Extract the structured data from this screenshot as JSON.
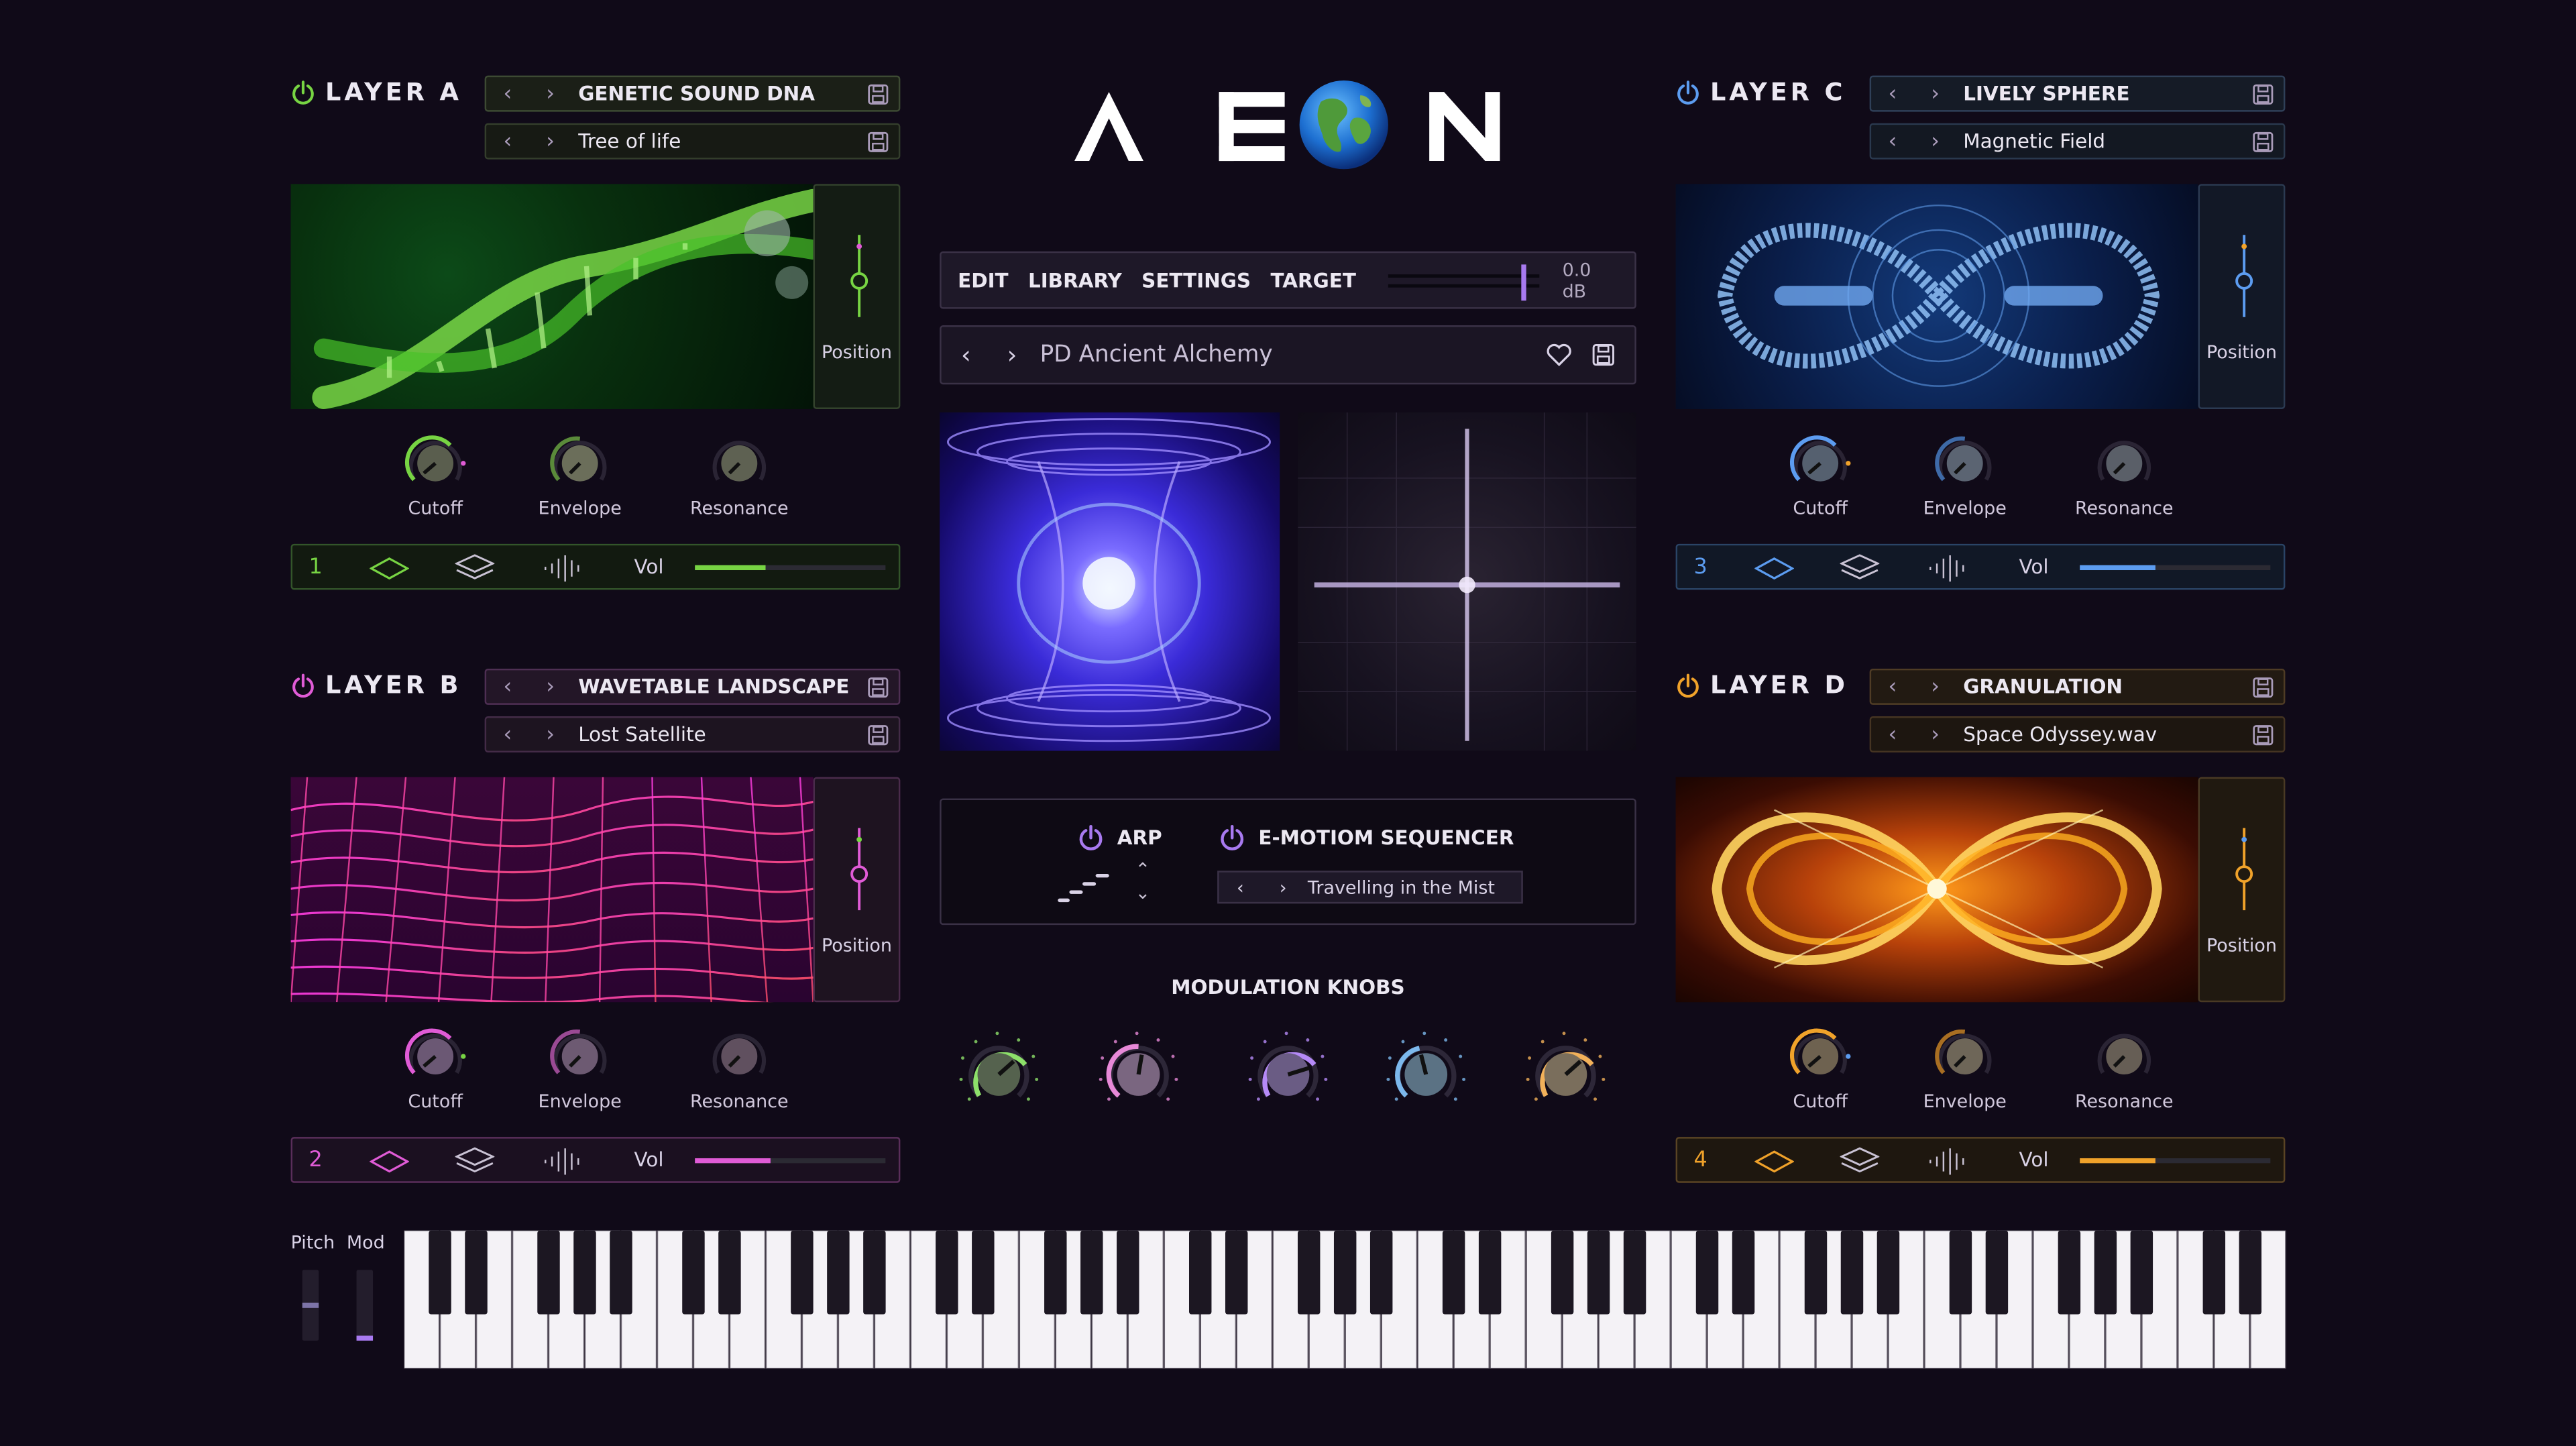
{
  "app": {
    "logo_text": "AEON",
    "logo_letters": [
      "A",
      "E",
      "N"
    ]
  },
  "colors": {
    "a": "#77d443",
    "b": "#e05bd6",
    "c": "#5c9cf0",
    "d": "#f0a22a",
    "bg": "#100a18"
  },
  "layers": [
    {
      "id": "a",
      "title": "LAYER A",
      "preset": "GENETIC SOUND DNA",
      "sample": "Tree of life",
      "position_label": "Position",
      "knobs": [
        "Cutoff",
        "Envelope",
        "Resonance"
      ],
      "number": "1",
      "vol_label": "Vol",
      "vol": 0.37
    },
    {
      "id": "b",
      "title": "LAYER B",
      "preset": "WAVETABLE LANDSCAPE",
      "sample": "Lost Satellite",
      "position_label": "Position",
      "knobs": [
        "Cutoff",
        "Envelope",
        "Resonance"
      ],
      "number": "2",
      "vol_label": "Vol",
      "vol": 0.4
    },
    {
      "id": "c",
      "title": "LAYER C",
      "preset": "LIVELY SPHERE",
      "sample": "Magnetic Field",
      "position_label": "Position",
      "knobs": [
        "Cutoff",
        "Envelope",
        "Resonance"
      ],
      "number": "3",
      "vol_label": "Vol",
      "vol": 0.4
    },
    {
      "id": "d",
      "title": "LAYER D",
      "preset": "GRANULATION",
      "sample": "Space Odyssey.wav",
      "position_label": "Position",
      "knobs": [
        "Cutoff",
        "Envelope",
        "Resonance"
      ],
      "number": "4",
      "vol_label": "Vol",
      "vol": 0.4
    }
  ],
  "menu": {
    "edit": "EDIT",
    "library": "LIBRARY",
    "settings": "SETTINGS",
    "target": "TARGET",
    "volume": "0.0 dB"
  },
  "preset": {
    "name": "PD Ancient Alchemy"
  },
  "arp": {
    "label": "ARP",
    "seq_label": "E-MOTIOM SEQUENCER",
    "seq_preset": "Travelling in the Mist"
  },
  "modulation": {
    "title": "MODULATION KNOBS",
    "colors": [
      "#8de06a",
      "#e889d8",
      "#b58af7",
      "#7cb8ec",
      "#f2b15a"
    ]
  },
  "keyboard": {
    "pitch_label": "Pitch",
    "mod_label": "Mod",
    "white_keys": 52
  },
  "icons": [
    "power-icon",
    "save-icon",
    "heart-icon",
    "chevron-left-icon",
    "chevron-right-icon",
    "diamond-icon",
    "layers-icon",
    "waveform-icon",
    "chevron-up-icon",
    "chevron-down-icon",
    "arp-steps-icon",
    "globe-icon"
  ]
}
